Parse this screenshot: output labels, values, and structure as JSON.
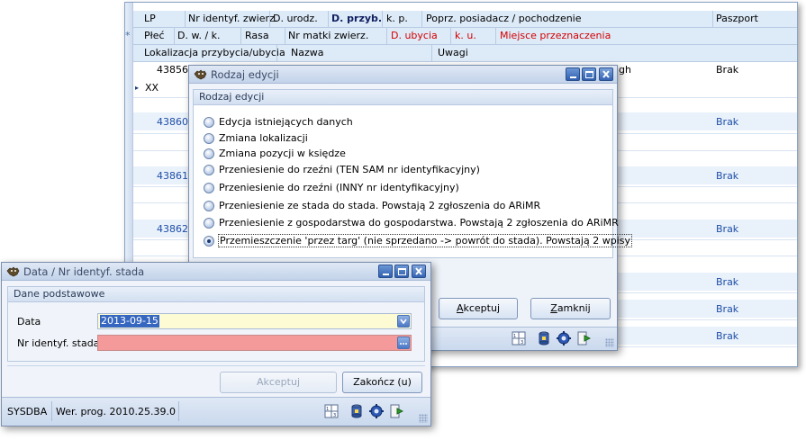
{
  "grid": {
    "header_row1": [
      "LP",
      "Nr identyf. zwierz.",
      "D. urodz.",
      "D. przyb.",
      "k. p.",
      "Poprz. posiadacz / pochodzenie",
      "Paszport"
    ],
    "header_row2": [
      "Płeć",
      "D. w. / k.",
      "Rasa",
      "Nr matki zwierz.",
      "D. ubycia",
      "k. u.",
      "Miejsce przeznaczenia"
    ],
    "header_row3": [
      "Lokalizacja przybycia/ubycia",
      "Nazwa",
      "Uwagi"
    ],
    "star_marker": "*",
    "current_marker": "▸",
    "rows": [
      {
        "lp": "43856",
        "sex": "XX",
        "paszport": "Brak",
        "pochodzenie_fragment": "gh"
      },
      {
        "lp": "43860",
        "paszport": "Brak"
      },
      {
        "lp": "43861",
        "paszport": "Brak"
      },
      {
        "lp": "43862",
        "paszport": "Brak"
      }
    ],
    "extra_paszport": [
      "Brak",
      "Brak",
      "Brak"
    ]
  },
  "edit_dialog": {
    "title": "Rodzaj edycji",
    "group_title": "Rodzaj edycji",
    "options": [
      "Edycja istniejących danych",
      "Zmiana lokalizacji",
      "Zmiana pozycji w księdze",
      "Przeniesienie do rzeźni (TEN SAM nr identyfikacyjny)",
      "Przeniesienie do rzeźni (INNY nr identyfikacyjny)",
      "Przeniesienie ze stada do stada. Powstają 2 zgłoszenia do ARiMR",
      "Przeniesienie z gospodarstwa do gospodarstwa. Powstają 2 zgłoszenia do ARiMR",
      "Przemieszczenie 'przez targ' (nie sprzedano -> powrót do stada). Powstają 2 wpisy"
    ],
    "selected_index": 7,
    "accept_label": "Akceptuj",
    "accept_hotkey": "A",
    "close_label": "Zamknij",
    "close_hotkey": "Z"
  },
  "data_dialog": {
    "title": "Data / Nr identyf. stada",
    "group_title": "Dane podstawowe",
    "date_label": "Data",
    "date_value": "2013-09-15",
    "herd_label": "Nr identyf. stada",
    "herd_value": "",
    "accept_label": "Akceptuj",
    "finish_label": "Zakończ (u)",
    "status_user": "SYSDBA",
    "status_version": "Wer. prog. 2010.25.39.0"
  },
  "icons": [
    "app-icon",
    "minimize-icon",
    "maximize-icon",
    "close-icon",
    "calculator-icon",
    "database-icon",
    "gear-icon",
    "exit-icon",
    "dropdown-icon",
    "ellipsis-icon"
  ],
  "colors": {
    "date_field_bg": "#fdfbd3",
    "herd_field_bg": "#f59a9a",
    "header_bg": "#ddeaf8",
    "red_text": "#d40000"
  }
}
